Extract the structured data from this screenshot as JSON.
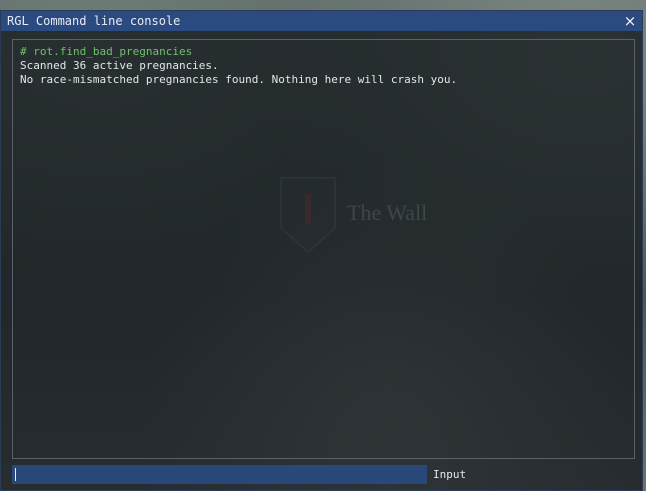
{
  "window": {
    "title": "RGL Command line console",
    "close_glyph": "×"
  },
  "background": {
    "banner_text": "The Wall"
  },
  "log": {
    "lines": [
      {
        "type": "command",
        "text": "# rot.find_bad_pregnancies"
      },
      {
        "type": "output",
        "text": "Scanned 36 active pregnancies."
      },
      {
        "type": "output",
        "text": "No race-mismatched pregnancies found. Nothing here will crash you."
      }
    ]
  },
  "input": {
    "value": "",
    "label": "Input"
  },
  "colors": {
    "title_bar": "#2a4a80",
    "command_text": "#6fc16a",
    "output_text": "#e4e7ea",
    "input_bg": "#274879"
  }
}
